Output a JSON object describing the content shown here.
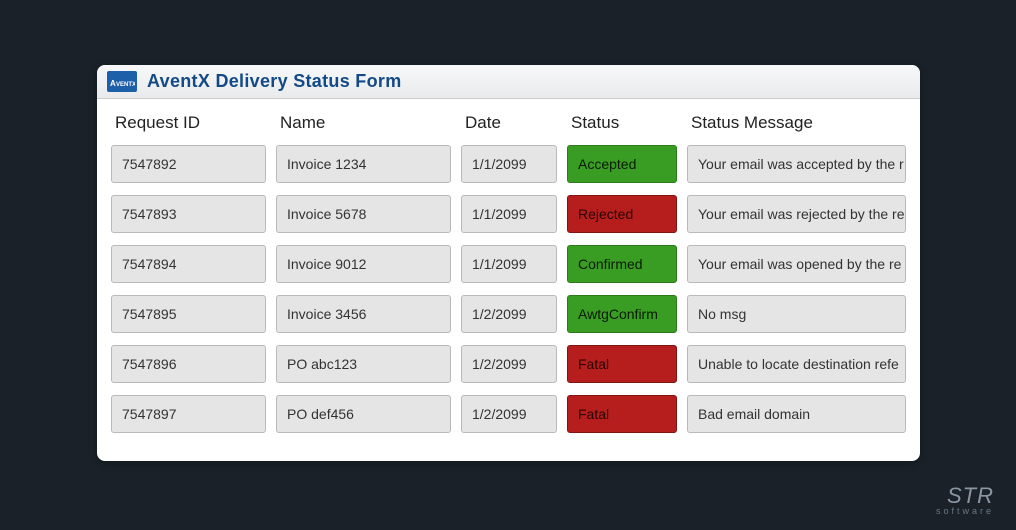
{
  "header": {
    "title": "AventX Delivery Status Form",
    "logo_text": "AventX"
  },
  "columns": {
    "request_id": "Request ID",
    "name": "Name",
    "date": "Date",
    "status": "Status",
    "message": "Status Message"
  },
  "rows": [
    {
      "id": "7547892",
      "name": "Invoice 1234",
      "date": "1/1/2099",
      "status": "Accepted",
      "status_color": "green",
      "message": "Your email was accepted by the r"
    },
    {
      "id": "7547893",
      "name": "Invoice 5678",
      "date": "1/1/2099",
      "status": "Rejected",
      "status_color": "red",
      "message": "Your email was rejected by the re"
    },
    {
      "id": "7547894",
      "name": "Invoice 9012",
      "date": "1/1/2099",
      "status": "Confirmed",
      "status_color": "green",
      "message": "Your email was opened by the re"
    },
    {
      "id": "7547895",
      "name": "Invoice 3456",
      "date": "1/2/2099",
      "status": "AwtgConfirm",
      "status_color": "green",
      "message": "No msg"
    },
    {
      "id": "7547896",
      "name": "PO abc123",
      "date": "1/2/2099",
      "status": "Fatal",
      "status_color": "red",
      "message": "Unable to locate destination refe"
    },
    {
      "id": "7547897",
      "name": "PO def456",
      "date": "1/2/2099",
      "status": "Fatal",
      "status_color": "red",
      "message": "Bad email domain"
    }
  ],
  "footer": {
    "brand_big": "STR",
    "brand_small": "software"
  },
  "colors": {
    "status_green": "#3a9d23",
    "status_red": "#b51e1c",
    "accent": "#134a86"
  }
}
